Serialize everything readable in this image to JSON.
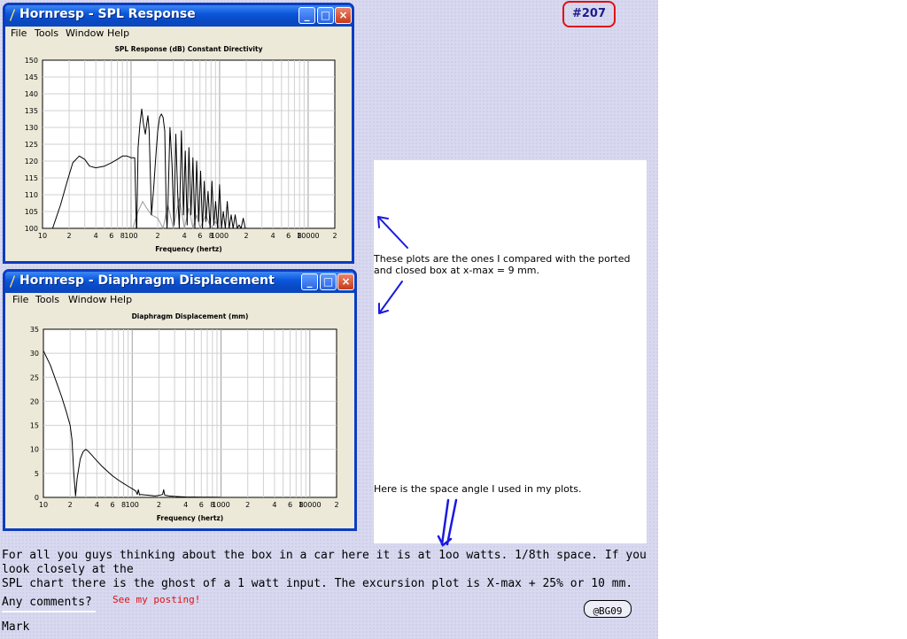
{
  "badge": "#207",
  "spl_window": {
    "title": "Hornresp - SPL Response",
    "menu": [
      "File",
      "Tools",
      "Window",
      "Help"
    ]
  },
  "disp_window": {
    "title": "Hornresp - Diaphragm Displacement",
    "menu": [
      "File",
      "Tools",
      "Window",
      "Help"
    ]
  },
  "window_buttons": {
    "minimize": "_",
    "maximize": "□",
    "close": "×"
  },
  "annotation": {
    "plots_note_line1": "These plots are the ones I compared with the  ported",
    "plots_note_line2": " and closed box at x-max = 9 mm.",
    "space_angle_note": "Here is the space angle I used in my plots."
  },
  "post": {
    "paragraph_line1": "For all you guys thinking about the box in a car here it is at 1oo watts. 1/8th space. If you look closely at the",
    "paragraph_line2": "SPL chart there is the ghost of a 1 watt input. The excursion plot is X-max + 25% or 10 mm.",
    "any_comments": "Any comments?",
    "see_posting": "See my posting!",
    "tag": "@BG09",
    "signature": "Mark"
  },
  "colors": {
    "titlebar": "#0b57dc",
    "badge_ring": "#e01010",
    "badge_text": "#1c1c8c",
    "see_posting": "#e01010",
    "arrow": "#1a1ae0"
  },
  "chart_data": [
    {
      "type": "line",
      "title": "SPL Response (dB)   Constant Directivity",
      "xlabel": "Frequency (hertz)",
      "ylabel": "",
      "xscale": "log",
      "xlim": [
        10,
        20000
      ],
      "ylim": [
        100,
        150
      ],
      "yticks": [
        100,
        105,
        110,
        115,
        120,
        125,
        130,
        135,
        140,
        145,
        150
      ],
      "xtick_labels": [
        {
          "v": 10,
          "t": "10"
        },
        {
          "v": 20,
          "t": "2"
        },
        {
          "v": 40,
          "t": "4"
        },
        {
          "v": 60,
          "t": "6"
        },
        {
          "v": 80,
          "t": "8"
        },
        {
          "v": 100,
          "t": "100"
        },
        {
          "v": 200,
          "t": "2"
        },
        {
          "v": 400,
          "t": "4"
        },
        {
          "v": 600,
          "t": "6"
        },
        {
          "v": 800,
          "t": "8"
        },
        {
          "v": 1000,
          "t": "1000"
        },
        {
          "v": 2000,
          "t": "2"
        },
        {
          "v": 4000,
          "t": "4"
        },
        {
          "v": 6000,
          "t": "6"
        },
        {
          "v": 8000,
          "t": "8"
        },
        {
          "v": 10000,
          "t": "10000"
        },
        {
          "v": 20000,
          "t": "2"
        }
      ],
      "grid": true,
      "series": [
        {
          "color": "#000000",
          "x": [
            13,
            16,
            19,
            22,
            26,
            30,
            34,
            40,
            50,
            60,
            70,
            80,
            90,
            100,
            110,
            115,
            116,
            120,
            126,
            132,
            138,
            145,
            150,
            155,
            160,
            170,
            180,
            190,
            200,
            210,
            220,
            230,
            240,
            250,
            255,
            260,
            275,
            290,
            305,
            320,
            335,
            350,
            370,
            390,
            410,
            430,
            450,
            475,
            500,
            525,
            550,
            580,
            610,
            640,
            670,
            700,
            740,
            780,
            820,
            860,
            900,
            950,
            1000,
            1050,
            1100,
            1160,
            1220,
            1280,
            1350,
            1420,
            1500,
            1580,
            1660,
            1750,
            1850,
            1950,
            2050
          ],
          "y": [
            100,
            107,
            114,
            119.5,
            121.5,
            120.5,
            118.5,
            118,
            118.5,
            119.5,
            120.5,
            121.5,
            121.5,
            121,
            121,
            100,
            100,
            124,
            131,
            135.5,
            131,
            128,
            131,
            133.5,
            129,
            104,
            112,
            121,
            129,
            133,
            134,
            133,
            129,
            104,
            100,
            106,
            130,
            119,
            101,
            128,
            111,
            100,
            129,
            104,
            123,
            101,
            124,
            104,
            121,
            100,
            120,
            102,
            117,
            100,
            114,
            102,
            111,
            100,
            114,
            101,
            108,
            100,
            113,
            100,
            105,
            100,
            108,
            100,
            104,
            100,
            104,
            100,
            101,
            100,
            103,
            100,
            100
          ]
        },
        {
          "color": "#9a9a9a",
          "x": [
            105,
            110,
            120,
            135,
            150,
            170,
            200,
            230,
            260,
            300,
            350,
            400,
            450,
            500,
            550,
            600,
            700,
            800,
            900,
            1000
          ],
          "y": [
            100,
            102,
            105,
            108,
            106,
            104,
            103,
            100,
            107,
            100,
            109,
            100,
            106,
            100,
            104,
            100,
            104,
            100,
            102,
            100
          ]
        }
      ]
    },
    {
      "type": "line",
      "title": "Diaphragm Displacement (mm)",
      "xlabel": "Frequency (hertz)",
      "ylabel": "",
      "xscale": "log",
      "xlim": [
        10,
        20000
      ],
      "ylim": [
        0,
        35
      ],
      "yticks": [
        0,
        5,
        10,
        15,
        20,
        25,
        30,
        35
      ],
      "xtick_labels": [
        {
          "v": 10,
          "t": "10"
        },
        {
          "v": 20,
          "t": "2"
        },
        {
          "v": 40,
          "t": "4"
        },
        {
          "v": 60,
          "t": "6"
        },
        {
          "v": 80,
          "t": "8"
        },
        {
          "v": 100,
          "t": "100"
        },
        {
          "v": 200,
          "t": "2"
        },
        {
          "v": 400,
          "t": "4"
        },
        {
          "v": 600,
          "t": "6"
        },
        {
          "v": 800,
          "t": "8"
        },
        {
          "v": 1000,
          "t": "1000"
        },
        {
          "v": 2000,
          "t": "2"
        },
        {
          "v": 4000,
          "t": "4"
        },
        {
          "v": 6000,
          "t": "6"
        },
        {
          "v": 8000,
          "t": "8"
        },
        {
          "v": 10000,
          "t": "10000"
        },
        {
          "v": 20000,
          "t": "2"
        }
      ],
      "grid": true,
      "series": [
        {
          "color": "#000000",
          "x": [
            10,
            12,
            14,
            16,
            18,
            20,
            21,
            22,
            23,
            24,
            26,
            28,
            30,
            32,
            35,
            40,
            45,
            50,
            60,
            70,
            80,
            90,
            100,
            110,
            114,
            117,
            121,
            125,
            140,
            160,
            180,
            200,
            220,
            226,
            232,
            240,
            260,
            300,
            350,
            400,
            500,
            600,
            800,
            1000
          ],
          "y": [
            30.5,
            27.5,
            24,
            21,
            18,
            15,
            12,
            5,
            0.3,
            4,
            8,
            9.5,
            10,
            9.6,
            8.8,
            7.6,
            6.6,
            5.8,
            4.5,
            3.6,
            2.9,
            2.3,
            1.8,
            1.3,
            0.6,
            1.6,
            0.5,
            0.6,
            0.5,
            0.4,
            0.3,
            0.4,
            0.6,
            1.6,
            0.5,
            0.4,
            0.3,
            0.2,
            0.15,
            0.1,
            0.07,
            0.05,
            0.03,
            0.02
          ]
        }
      ]
    }
  ]
}
